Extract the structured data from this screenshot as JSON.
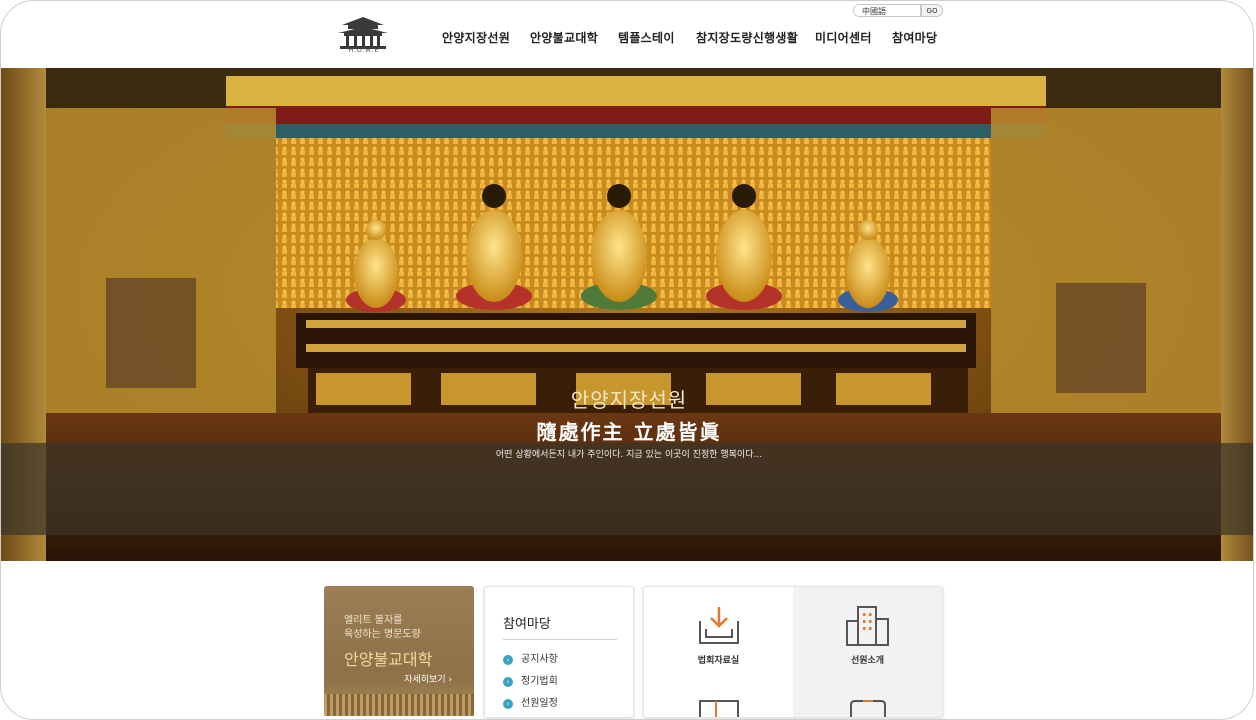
{
  "header": {
    "logo_text": "H.O.M.E",
    "lang_select": "中國語",
    "lang_go": "GO",
    "nav": [
      {
        "label": "안양지장선원"
      },
      {
        "label": "안양불교대학"
      },
      {
        "label": "템플스테이"
      },
      {
        "label": "참지장도량신행생활"
      },
      {
        "label": "미디어센터"
      },
      {
        "label": "참여마당"
      }
    ]
  },
  "hero": {
    "title": "안양지장선원",
    "hanja": "隨處作主 立處皆眞",
    "subtitle": "어떤 상황에서든지 내가 주인이다. 지금 있는 이곳이 진정한 행복이다..."
  },
  "univ_card": {
    "line1": "엘리트 불자를",
    "line2": "육성하는 명문도량",
    "title": "안양불교대학",
    "more": "자세히보기 ›"
  },
  "board_card": {
    "title": "참여마당",
    "items": [
      {
        "label": "공지사항"
      },
      {
        "label": "정기법회"
      },
      {
        "label": "선원일정"
      }
    ]
  },
  "links_card": {
    "items": [
      {
        "label": "법회자료실",
        "icon": "download-tray-icon"
      },
      {
        "label": "선원소개",
        "icon": "building-icon"
      }
    ]
  },
  "colors": {
    "accent_teal": "#3aa3bf",
    "icon_orange": "#e07a2e",
    "univ_bg": "#9b7e55"
  }
}
